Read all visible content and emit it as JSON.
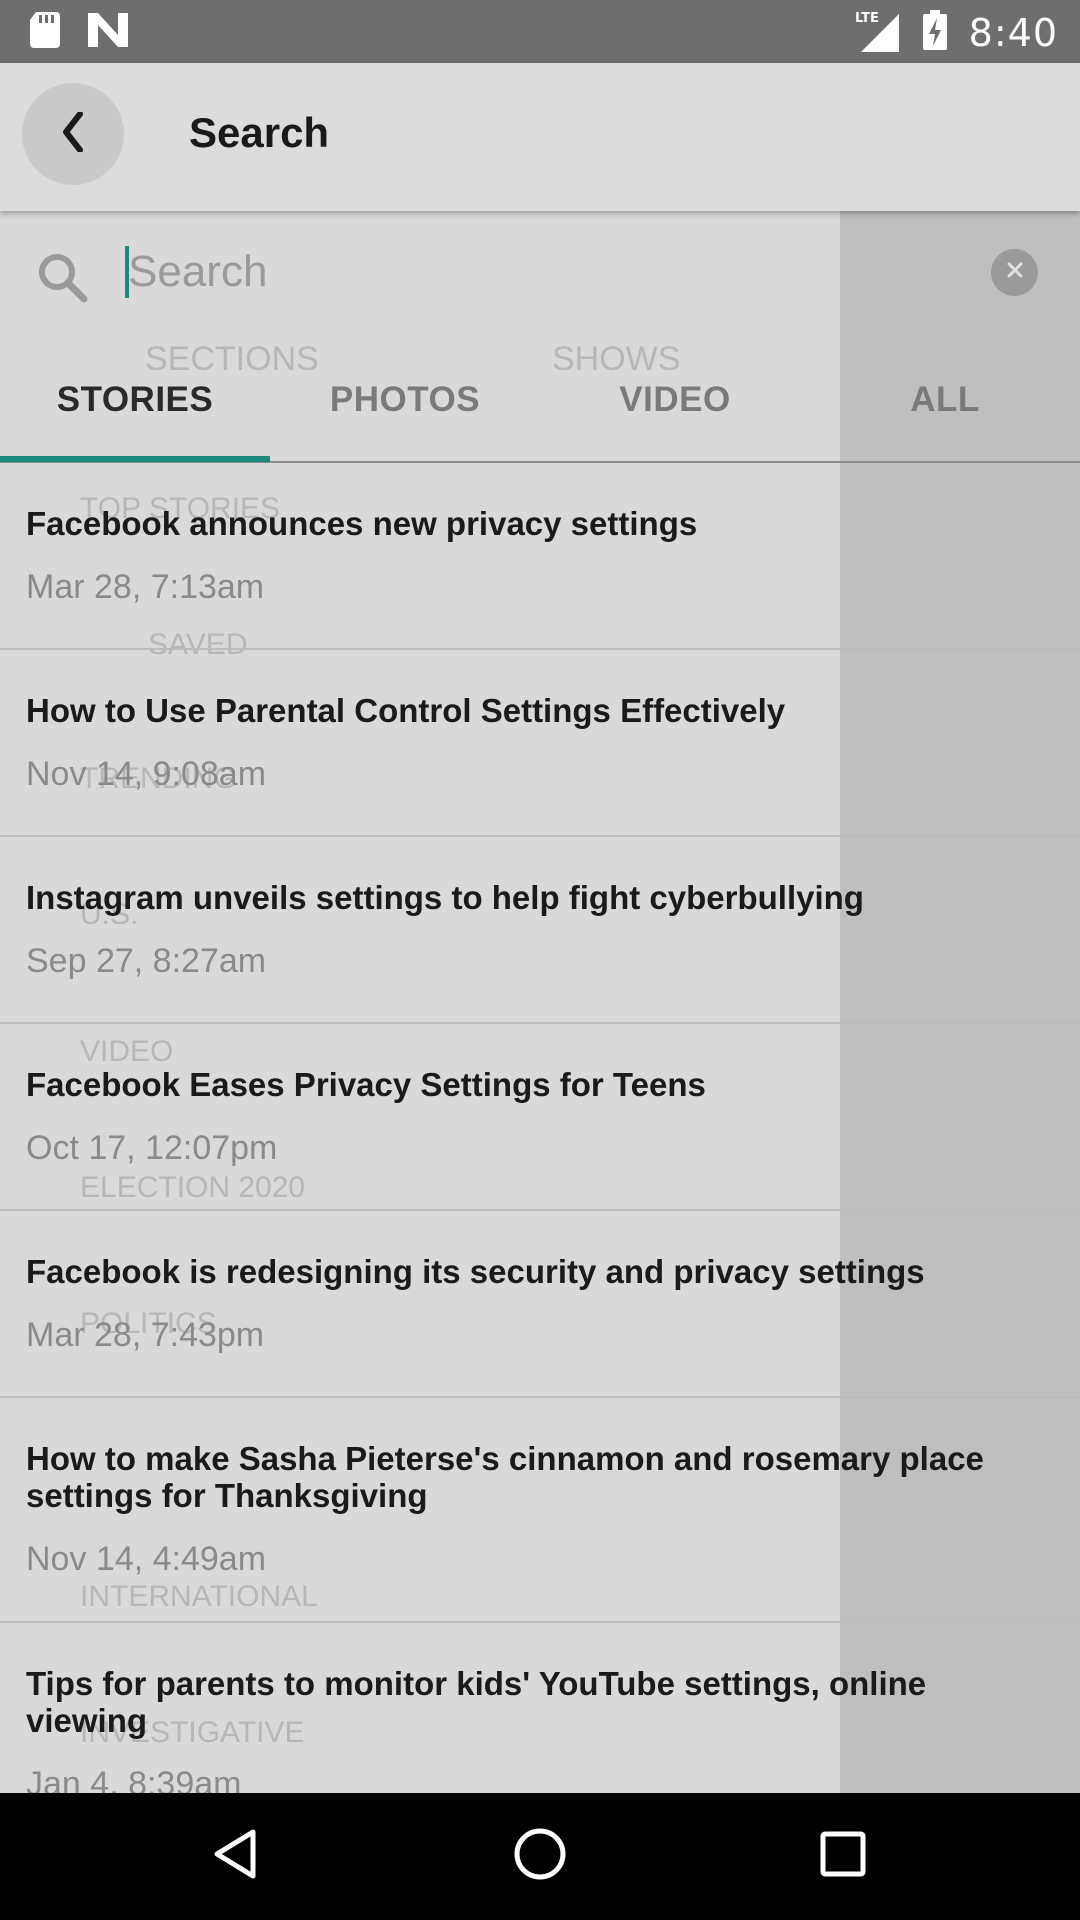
{
  "status_bar": {
    "network": "LTE",
    "time": "8:40"
  },
  "app_bar": {
    "title": "Search"
  },
  "search": {
    "placeholder": "Search",
    "value": ""
  },
  "tabs": [
    {
      "label": "STORIES",
      "active": true
    },
    {
      "label": "PHOTOS",
      "active": false
    },
    {
      "label": "VIDEO",
      "active": false
    },
    {
      "label": "ALL",
      "active": false
    }
  ],
  "results": [
    {
      "title": "Facebook announces new privacy settings",
      "date": "Mar 28, 7:13am"
    },
    {
      "title": "How to Use Parental Control Settings Effectively",
      "date": "Nov 14, 9:08am"
    },
    {
      "title": "Instagram unveils settings to help fight cyberbullying",
      "date": "Sep 27, 8:27am"
    },
    {
      "title": "Facebook Eases Privacy Settings for Teens",
      "date": "Oct 17, 12:07pm"
    },
    {
      "title": "Facebook is redesigning its security and privacy settings",
      "date": "Mar 28, 7:43pm"
    },
    {
      "title": "How to make Sasha Pieterse's cinnamon and rosemary place settings for Thanksgiving",
      "date": "Nov 14, 4:49am"
    },
    {
      "title": "Tips for parents to monitor kids' YouTube settings, online viewing",
      "date": "Jan 4, 8:39am"
    }
  ],
  "background_menu": {
    "sections_label": "SECTIONS",
    "shows_label": "SHOWS",
    "items": [
      "TOP STORIES",
      "SAVED",
      "TRENDING",
      "U.S.",
      "VIDEO",
      "ELECTION 2020",
      "POLITICS",
      "INTERNATIONAL",
      "INVESTIGATIVE"
    ]
  },
  "colors": {
    "accent": "#1a8a7a",
    "status_bar": "#6e6e6e",
    "nav_bar": "#000000"
  },
  "icons": {
    "back": "chevron-left-icon",
    "search": "search-icon",
    "clear": "clear-icon",
    "nav_back": "triangle-back-icon",
    "nav_home": "circle-home-icon",
    "nav_recents": "square-recents-icon"
  }
}
